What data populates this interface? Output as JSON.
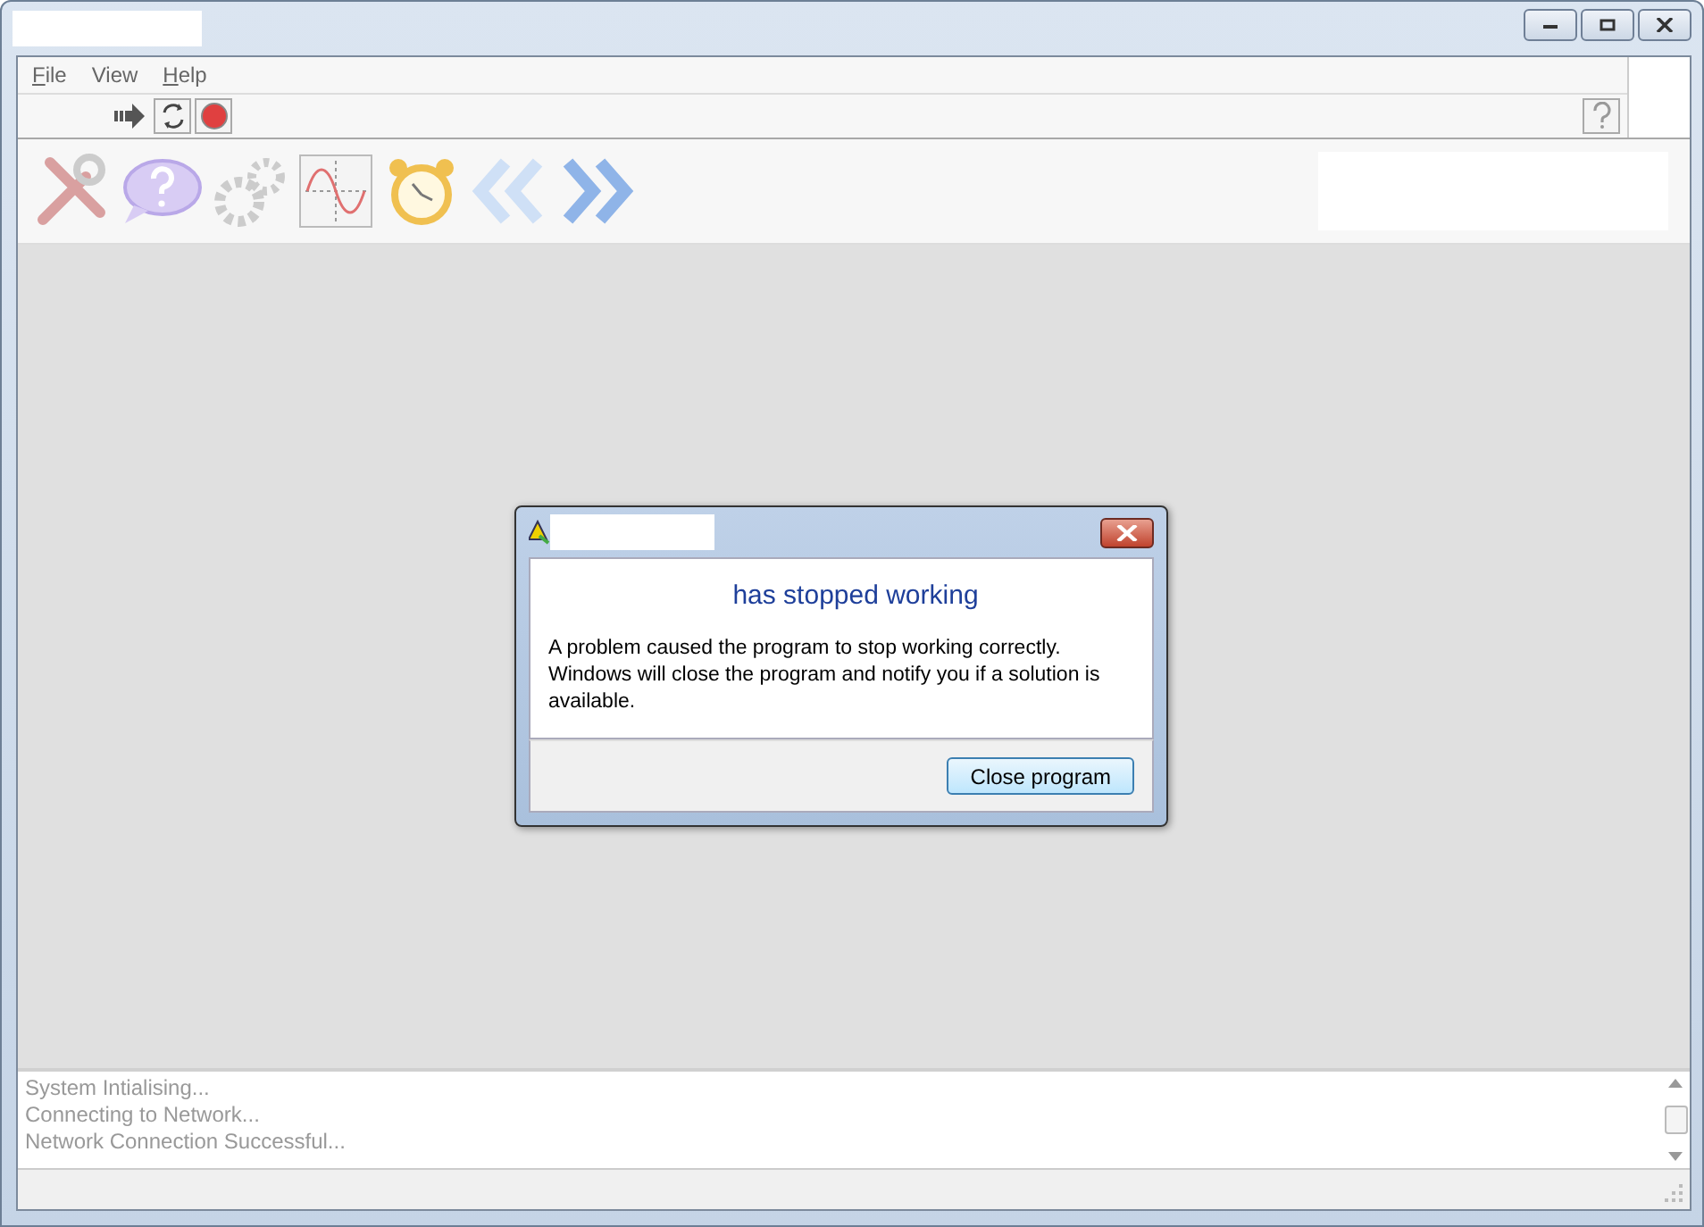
{
  "menu": [
    {
      "label": "File"
    },
    {
      "label": "View"
    },
    {
      "label": "Help"
    }
  ],
  "dialog": {
    "heading": "has stopped working",
    "message": "A problem caused the program to stop working correctly. Windows will close the program and notify you if a solution is available.",
    "button": "Close program"
  },
  "log": [
    "System Intialising...",
    "Connecting to Network...",
    "Network Connection Successful..."
  ]
}
